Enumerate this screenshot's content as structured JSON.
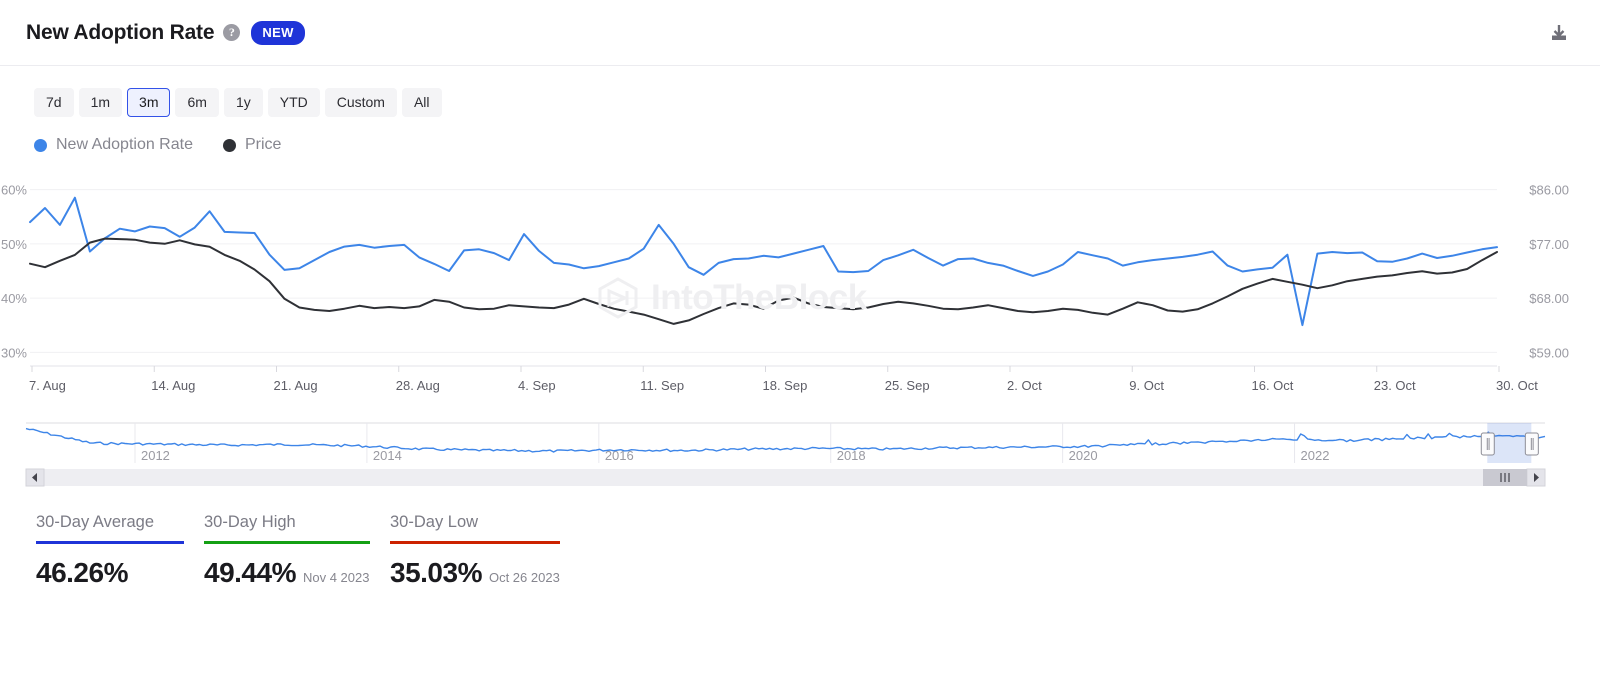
{
  "header": {
    "title": "New Adoption Rate",
    "help_icon": "question-mark-icon",
    "badge": "NEW",
    "download_icon": "download-icon"
  },
  "ranges": {
    "selected": "3m",
    "options": [
      "7d",
      "1m",
      "3m",
      "6m",
      "1y",
      "YTD",
      "Custom",
      "All"
    ]
  },
  "legend": [
    {
      "label": "New Adoption Rate",
      "color": "#3d85e8"
    },
    {
      "label": "Price",
      "color": "#2f3136"
    }
  ],
  "watermark": {
    "text": "IntoTheBlock"
  },
  "navigator": {
    "year_labels": [
      "2012",
      "2014",
      "2016",
      "2018",
      "2020",
      "2022"
    ],
    "left_arrow": "scroll-left-icon",
    "right_arrow": "scroll-right-icon",
    "selection_start_pct": 96.2,
    "selection_end_pct": 99.1
  },
  "stats": [
    {
      "label": "30-Day Average",
      "value": "46.26%",
      "date": "",
      "color": "#1f34d8"
    },
    {
      "label": "30-Day High",
      "value": "49.44%",
      "date": "Nov 4 2023",
      "color": "#14a014"
    },
    {
      "label": "30-Day Low",
      "value": "35.03%",
      "date": "Oct 26 2023",
      "color": "#cc2200"
    }
  ],
  "chart_data": {
    "type": "line",
    "title": "New Adoption Rate",
    "xlabel": "",
    "ylabel": "New Adoption Rate",
    "y2label": "Price",
    "grid": true,
    "legend_position": "top-left",
    "x_tick_labels": [
      "7. Aug",
      "14. Aug",
      "21. Aug",
      "28. Aug",
      "4. Sep",
      "11. Sep",
      "18. Sep",
      "25. Sep",
      "2. Oct",
      "9. Oct",
      "16. Oct",
      "23. Oct",
      "30. Oct"
    ],
    "y_left_ticks": [
      "30%",
      "40%",
      "50%",
      "60%"
    ],
    "y_left_range": [
      27.5,
      62.5
    ],
    "y_right_ticks": [
      "$59.00",
      "$68.00",
      "$77.00",
      "$86.00"
    ],
    "y_right_range": [
      56.5,
      89.0
    ],
    "series": [
      {
        "name": "New Adoption Rate",
        "color": "#3d85e8",
        "axis": "left",
        "unit": "%",
        "values": [
          54.0,
          56.6,
          53.5,
          58.5,
          48.6,
          51.0,
          52.8,
          52.3,
          53.2,
          52.9,
          51.3,
          53.0,
          56.0,
          52.2,
          52.1,
          52.0,
          48.0,
          45.2,
          45.5,
          47.0,
          48.5,
          49.5,
          49.8,
          49.3,
          49.6,
          49.8,
          47.5,
          46.3,
          45.0,
          48.8,
          49.0,
          48.3,
          47.0,
          51.8,
          48.7,
          46.5,
          46.2,
          45.5,
          45.9,
          46.6,
          47.3,
          49.1,
          53.5,
          50.0,
          45.7,
          44.3,
          46.5,
          47.2,
          47.3,
          47.8,
          47.5,
          48.2,
          48.9,
          49.6,
          44.9,
          44.8,
          45.0,
          47.0,
          47.9,
          48.9,
          47.4,
          46.0,
          47.2,
          47.3,
          46.5,
          46.0,
          45.0,
          44.1,
          44.9,
          46.2,
          48.5,
          47.9,
          47.3,
          46.0,
          46.6,
          47.0,
          47.3,
          47.6,
          48.0,
          48.6,
          46.0,
          44.9,
          45.3,
          45.6,
          48.0,
          35.03,
          48.2,
          48.5,
          48.3,
          48.4,
          46.8,
          46.7,
          47.3,
          48.2,
          47.4,
          47.8,
          48.4,
          49.0,
          49.4
        ],
        "min": 35.03,
        "max": 58.5
      },
      {
        "name": "Price",
        "color": "#2f3136",
        "axis": "right",
        "unit": "$",
        "values": [
          74.0,
          73.4,
          74.5,
          75.5,
          77.6,
          78.3,
          78.2,
          78.1,
          77.6,
          77.4,
          78.0,
          77.3,
          76.9,
          75.5,
          74.5,
          73.0,
          71.0,
          68.0,
          66.5,
          66.1,
          65.9,
          66.3,
          66.8,
          66.4,
          66.6,
          66.4,
          66.7,
          67.8,
          67.5,
          66.5,
          66.2,
          66.3,
          66.9,
          66.7,
          66.5,
          66.4,
          67.0,
          68.0,
          67.1,
          66.3,
          65.8,
          65.3,
          64.5,
          63.7,
          64.3,
          65.4,
          66.4,
          67.2,
          67.0,
          66.3,
          67.7,
          68.2,
          67.2,
          66.6,
          66.4,
          66.2,
          66.5,
          67.1,
          67.5,
          67.2,
          66.8,
          66.3,
          66.2,
          66.5,
          66.9,
          66.4,
          65.9,
          65.7,
          65.9,
          66.3,
          66.1,
          65.6,
          65.3,
          66.3,
          67.4,
          66.9,
          66.0,
          65.8,
          66.2,
          67.2,
          68.4,
          69.7,
          70.6,
          71.4,
          70.9,
          70.4,
          69.8,
          70.3,
          71.0,
          71.4,
          71.8,
          72.0,
          72.4,
          72.7,
          72.3,
          72.5,
          73.1,
          74.6,
          76.0
        ],
        "min": 63.7,
        "max": 78.3
      }
    ]
  }
}
